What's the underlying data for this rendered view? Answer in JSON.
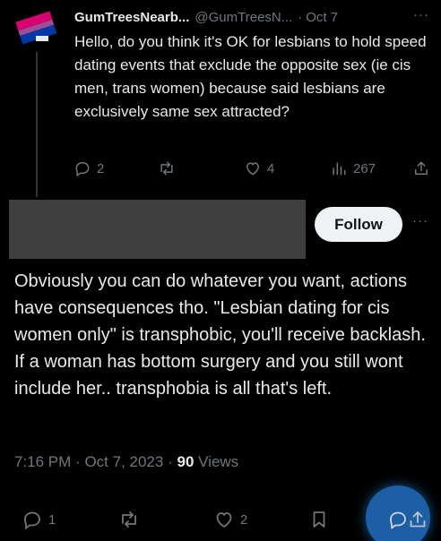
{
  "quoted_post": {
    "author_name": "GumTreesNearb...",
    "author_handle": "@GumTreesN...",
    "separator": "·",
    "date": "Oct 7",
    "more": "···",
    "text": "Hello, do you think it's OK for lesbians to hold speed dating events that exclude the opposite sex (ie cis men, trans women) because said lesbians are exclusively same sex attracted?",
    "actions": {
      "replies": "2",
      "reposts": "",
      "likes": "4",
      "views": "267"
    }
  },
  "main_post": {
    "follow_label": "Follow",
    "more": "···",
    "text": "Obviously you can do whatever you want, actions have consequences tho. \"Lesbian dating for cis women only\" is transphobic, you'll receive backlash. If a woman has bottom surgery and you still wont include her.. transphobia is all that's left.",
    "time": "7:16 PM",
    "date": "Oct 7, 2023",
    "views_count": "90",
    "views_label": "Views",
    "meta_separator": "·",
    "actions": {
      "replies": "1",
      "reposts": "",
      "likes": "2"
    }
  },
  "colors": {
    "background": "#000000",
    "text_primary": "#e7e9ea",
    "text_secondary": "#71767b",
    "follow_bg": "#eff3f4",
    "fab_blue": "#1d9bf0"
  }
}
